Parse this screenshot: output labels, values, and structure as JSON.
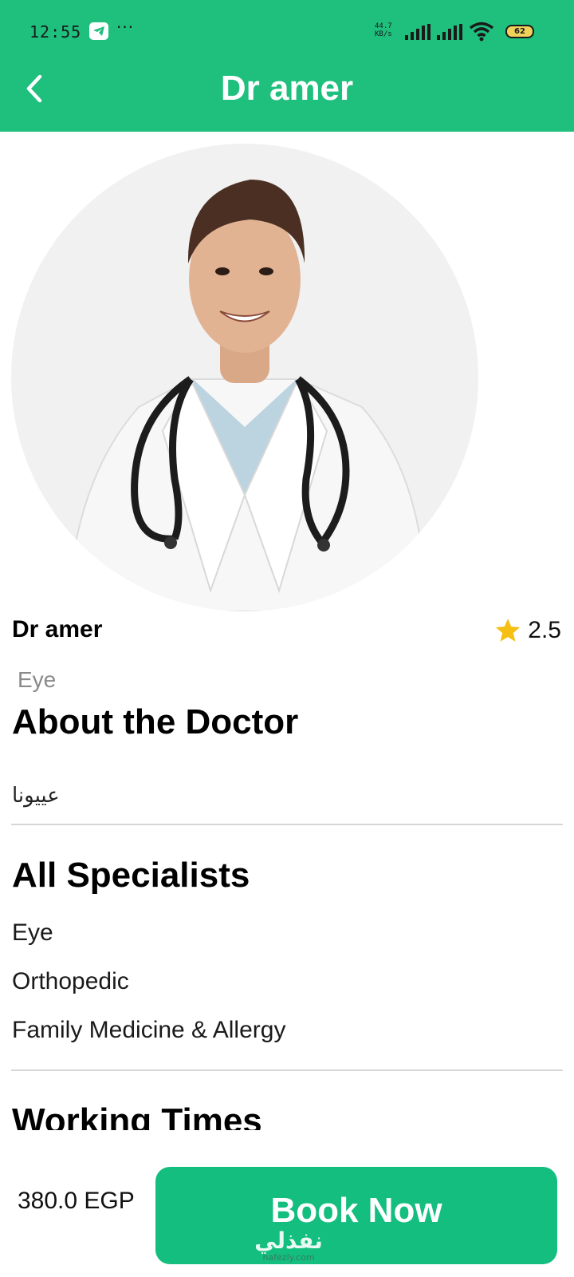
{
  "status_bar": {
    "time": "12:55",
    "more": "···",
    "net_speed_value": "44.7",
    "net_speed_unit": "KB/s",
    "battery": "62"
  },
  "header": {
    "title": "Dr amer",
    "back_icon": "back-arrow-icon",
    "color": "#1fbf7e"
  },
  "doctor": {
    "name": "Dr amer",
    "rating": "2.5",
    "specialty": "Eye"
  },
  "about": {
    "title": "About the Doctor",
    "text": "عييونا"
  },
  "specialists": {
    "title": "All Specialists",
    "items": [
      "Eye",
      "Orthopedic",
      "Family Medicine & Allergy"
    ]
  },
  "working_times": {
    "title": "Working Times"
  },
  "booking": {
    "price": "380.0 EGP",
    "button_label": "Book Now",
    "button_color": "#13be7f"
  },
  "watermark": {
    "arabic": "نفذلي",
    "latin": "nafezly.com"
  }
}
